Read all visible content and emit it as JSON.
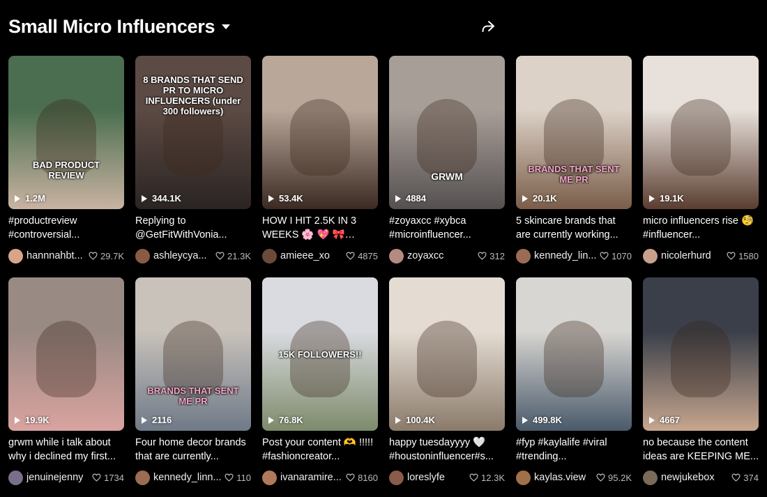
{
  "header": {
    "title": "Small Micro Influencers"
  },
  "videos": [
    {
      "views": "1.2M",
      "caption": "#productreview #controversial...",
      "user": "hannnahbt...",
      "likes": "29.7K",
      "overlay": "BAD PRODUCT REVIEW",
      "bg": "#4a6e4f",
      "bg2": "#c9b3a2",
      "avatar": "#d9a58a"
    },
    {
      "views": "344.1K",
      "caption": "Replying to @GetFitWithVonia...",
      "user": "ashleycya...",
      "likes": "21.3K",
      "overlay": "8 BRANDS THAT SEND PR TO MICRO INFLUENCERS (under 300 followers)",
      "bg": "#5c4a44",
      "bg2": "#2a2422",
      "avatar": "#8a5a44"
    },
    {
      "views": "53.4K",
      "caption": "HOW I HIT 2.5K IN 3 WEEKS 🌸 💖 🎀 thank...",
      "user": "amieee_xo",
      "likes": "4875",
      "overlay": "",
      "bg": "#b9a79a",
      "bg2": "#3b2a22",
      "avatar": "#6b4a3a"
    },
    {
      "views": "4884",
      "caption": "#zoyaxcc #xybca #microinfluencer...",
      "user": "zoyaxcc",
      "likes": "312",
      "overlay": "GRWM",
      "bg": "#a89e98",
      "bg2": "#555050",
      "avatar": "#b58a80"
    },
    {
      "views": "20.1K",
      "caption": "5 skincare brands that are currently working...",
      "user": "kennedy_lin...",
      "likes": "1070",
      "overlay": "BRANDS THAT SENT ME PR",
      "bg": "#ddd2c8",
      "bg2": "#7a5d49",
      "avatar": "#9c6b53"
    },
    {
      "views": "19.1K",
      "caption": "micro influencers rise 🧐 #influencer...",
      "user": "nicolerhurd",
      "likes": "1580",
      "overlay": "",
      "bg": "#e8e1db",
      "bg2": "#5a3d30",
      "avatar": "#c9a08c"
    },
    {
      "views": "19.9K",
      "caption": "grwm while i talk about why i declined my first...",
      "user": "jenuinejenny",
      "likes": "1734",
      "overlay": "",
      "bg": "#9a8a84",
      "bg2": "#d9a3a0",
      "avatar": "#7a6f8a"
    },
    {
      "views": "2116",
      "caption": "Four home decor brands that are currently...",
      "user": "kennedy_linn...",
      "likes": "110",
      "overlay": "BRANDS THAT SENT ME PR",
      "bg": "#c8c2bb",
      "bg2": "#6f7a88",
      "avatar": "#9c6b53"
    },
    {
      "views": "76.8K",
      "caption": "Post your content 🫶 !!!!! #fashioncreator...",
      "user": "ivanaramire...",
      "likes": "8160",
      "overlay": "15K FOLLOWERS!!",
      "bg": "#d9dbe0",
      "bg2": "#7d8a6a",
      "avatar": "#b07a5a"
    },
    {
      "views": "100.4K",
      "caption": "happy tuesdayyyy 🤍 #houstoninfluencer#s...",
      "user": "loreslyfe",
      "likes": "12.3K",
      "overlay": "",
      "bg": "#e4dcd3",
      "bg2": "#8a7a6a",
      "avatar": "#8a5a4a"
    },
    {
      "views": "499.8K",
      "caption": "#fyp #kaylalife #viral #trending...",
      "user": "kaylas.view",
      "likes": "95.2K",
      "overlay": "",
      "bg": "#d8d6d2",
      "bg2": "#4a5a6a",
      "avatar": "#a0704a"
    },
    {
      "views": "4667",
      "caption": "no because the content ideas are KEEPING ME...",
      "user": "newjukebox",
      "likes": "374",
      "overlay": "",
      "bg": "#3a3f4a",
      "bg2": "#c7a68e",
      "avatar": "#7a6a5a"
    }
  ]
}
